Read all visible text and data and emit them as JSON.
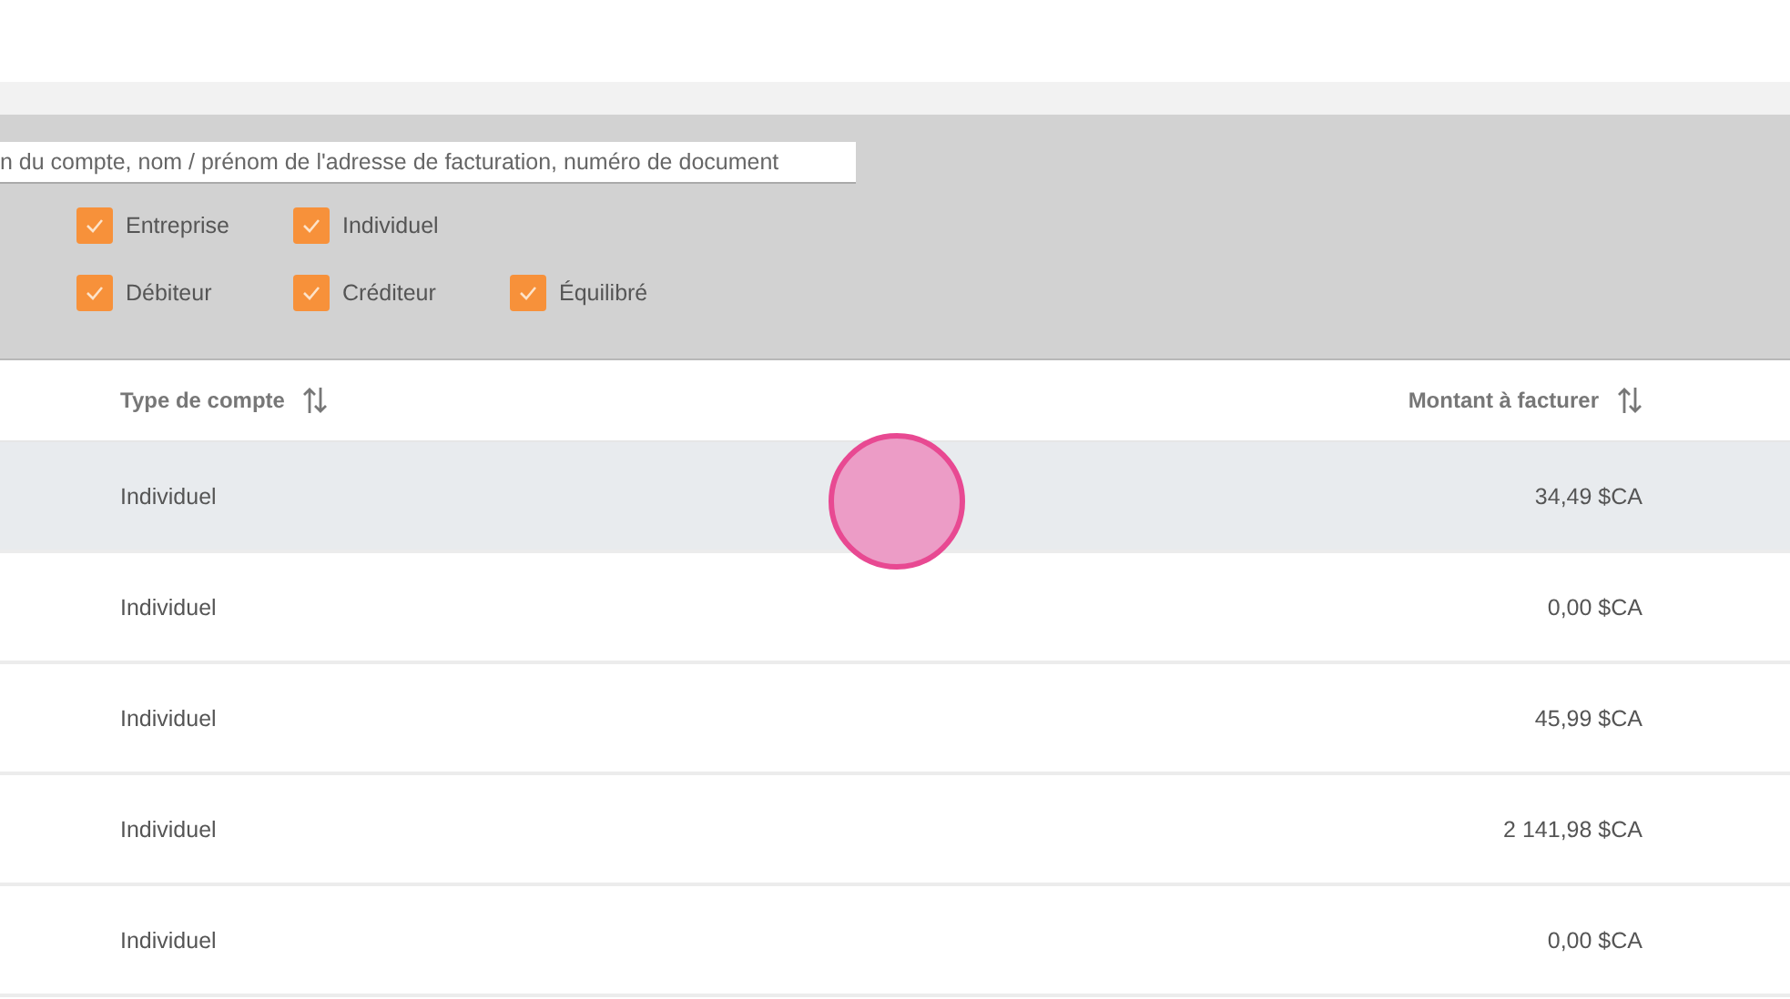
{
  "search": {
    "placeholder": "n du compte, nom / prénom de l'adresse de facturation, numéro de document"
  },
  "filter_groups": [
    {
      "options": [
        {
          "label": "Entreprise",
          "checked": true
        },
        {
          "label": "Individuel",
          "checked": true
        }
      ]
    },
    {
      "options": [
        {
          "label": "Débiteur",
          "checked": true
        },
        {
          "label": "Créditeur",
          "checked": true
        },
        {
          "label": "Équilibré",
          "checked": true
        }
      ]
    }
  ],
  "table": {
    "columns": [
      {
        "label": "Type de compte"
      },
      {
        "label": "Montant à facturer"
      }
    ],
    "rows": [
      {
        "account_type": "Individuel",
        "amount": "34,49 $CA",
        "selected": true
      },
      {
        "account_type": "Individuel",
        "amount": "0,00 $CA",
        "selected": false
      },
      {
        "account_type": "Individuel",
        "amount": "45,99 $CA",
        "selected": false
      },
      {
        "account_type": "Individuel",
        "amount": "2 141,98 $CA",
        "selected": false
      },
      {
        "account_type": "Individuel",
        "amount": "0,00 $CA",
        "selected": false
      }
    ]
  },
  "touch_indicator": {
    "on": true
  }
}
